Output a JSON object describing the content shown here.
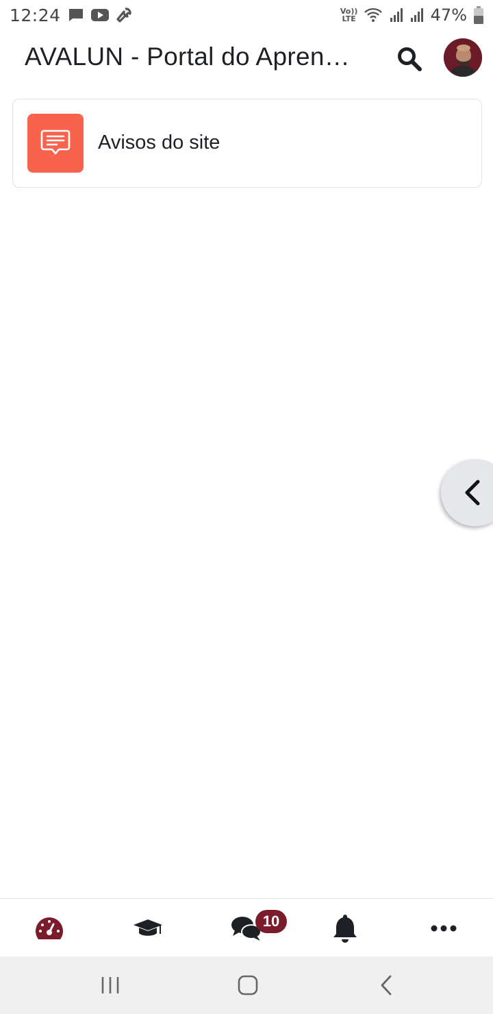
{
  "status_bar": {
    "time": "12:24",
    "battery": "47%",
    "network_label": "Vo)) LTE",
    "left_icons": [
      "message-icon",
      "youtube-icon",
      "wrench-icon"
    ],
    "right_icons": [
      "volte-icon",
      "wifi-icon",
      "signal-icon",
      "signal-icon",
      "battery-icon"
    ]
  },
  "app_bar": {
    "title": "AVALUN - Portal do Aprendizagem",
    "search_icon": "search-icon",
    "avatar_icon": "user-avatar"
  },
  "main": {
    "cards": [
      {
        "label": "Avisos do site",
        "icon": "forum-message-icon",
        "icon_color": "#f7634d"
      }
    ]
  },
  "drawer_handle": {
    "icon": "chevron-left-icon",
    "color": "#e5e7ea"
  },
  "tab_bar": {
    "tabs": [
      {
        "name": "dashboard",
        "icon": "dashboard-gauge-icon",
        "active": true
      },
      {
        "name": "courses",
        "icon": "graduation-cap-icon",
        "active": false
      },
      {
        "name": "messages",
        "icon": "chat-bubbles-icon",
        "active": false,
        "badge": "10"
      },
      {
        "name": "notifications",
        "icon": "bell-icon",
        "active": false
      },
      {
        "name": "more",
        "icon": "more-dots-icon",
        "active": false
      }
    ],
    "accent_color": "#7a1c2b"
  },
  "system_nav": {
    "buttons": [
      "recents-icon",
      "home-icon",
      "back-icon"
    ]
  }
}
